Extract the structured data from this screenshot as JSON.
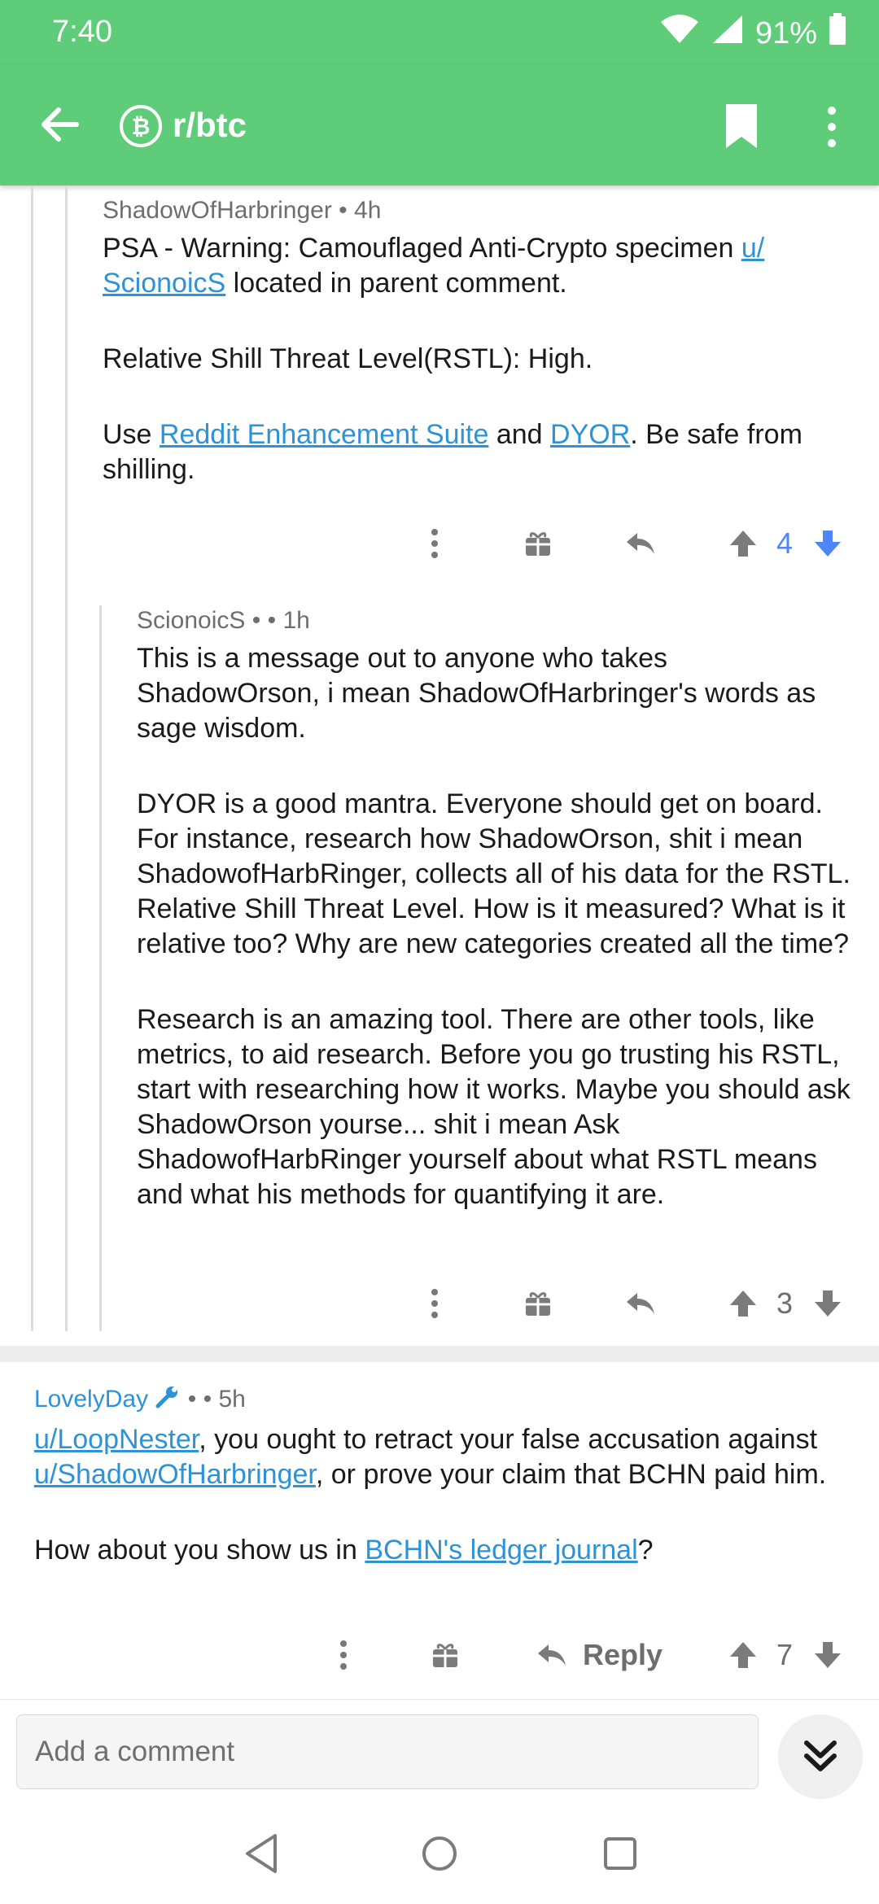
{
  "status_bar": {
    "time": "7:40",
    "battery": "91%"
  },
  "app_bar": {
    "subreddit": "r/btc"
  },
  "comments": [
    {
      "author": "ShadowOfHarbringer",
      "separator": "•",
      "age": "4h",
      "p1_a": "PSA - Warning: Camouflaged Anti-Crypto specimen ",
      "p1_link_a": "u/",
      "p1_link_b": "ScionoicS",
      "p1_b": " located in parent comment.",
      "p2": "Relative Shill Threat Level(RSTL): High.",
      "p3_a": "Use ",
      "p3_link1": "Reddit Enhancement Suite",
      "p3_b": " and ",
      "p3_link2": "DYOR",
      "p3_c": ". Be safe from",
      "p3_d": "shilling.",
      "score": "4",
      "vote_state": "upvoted"
    },
    {
      "author": "ScionoicS",
      "separator": "•  •",
      "age": "1h",
      "p1": "This is a message out to anyone who takes ShadowOrson, i mean ShadowOfHarbringer's words as sage wisdom.",
      "p2": "DYOR is a good mantra. Everyone should get on board.  For instance, research how ShadowOrson, shit i mean ShadowofHarbRinger, collects all of his data for the RSTL.  Relative Shill Threat Level.  How is it measured? What is it relative too? Why are new categories created all the time?",
      "p3": "Research is an amazing tool. There are other tools, like metrics, to aid research. Before you go trusting his RSTL, start with researching how it works.  Maybe you should ask ShadowOrson yourse... shit i mean Ask ShadowofHarbRinger yourself about what RSTL means and what his methods for quantifying it are.",
      "score": "3"
    },
    {
      "author": "LovelyDay",
      "separator": "•  •",
      "age": "5h",
      "p1_link1": "u/LoopNester",
      "p1_a": ", you ought to retract your false accusation against ",
      "p1_link2": "u/ShadowOfHarbringer",
      "p1_b": ", or prove your claim that BCHN paid him.",
      "p2_a": "How about you show us in ",
      "p2_link": "BCHN's ledger journal",
      "p2_b": "?",
      "reply_label": "Reply",
      "score": "7"
    }
  ],
  "composer": {
    "placeholder": "Add a comment"
  },
  "colors": {
    "brand_green": "#5fcc7a",
    "link_blue": "#2e93d6",
    "upvote_blue": "#4f86f7"
  }
}
